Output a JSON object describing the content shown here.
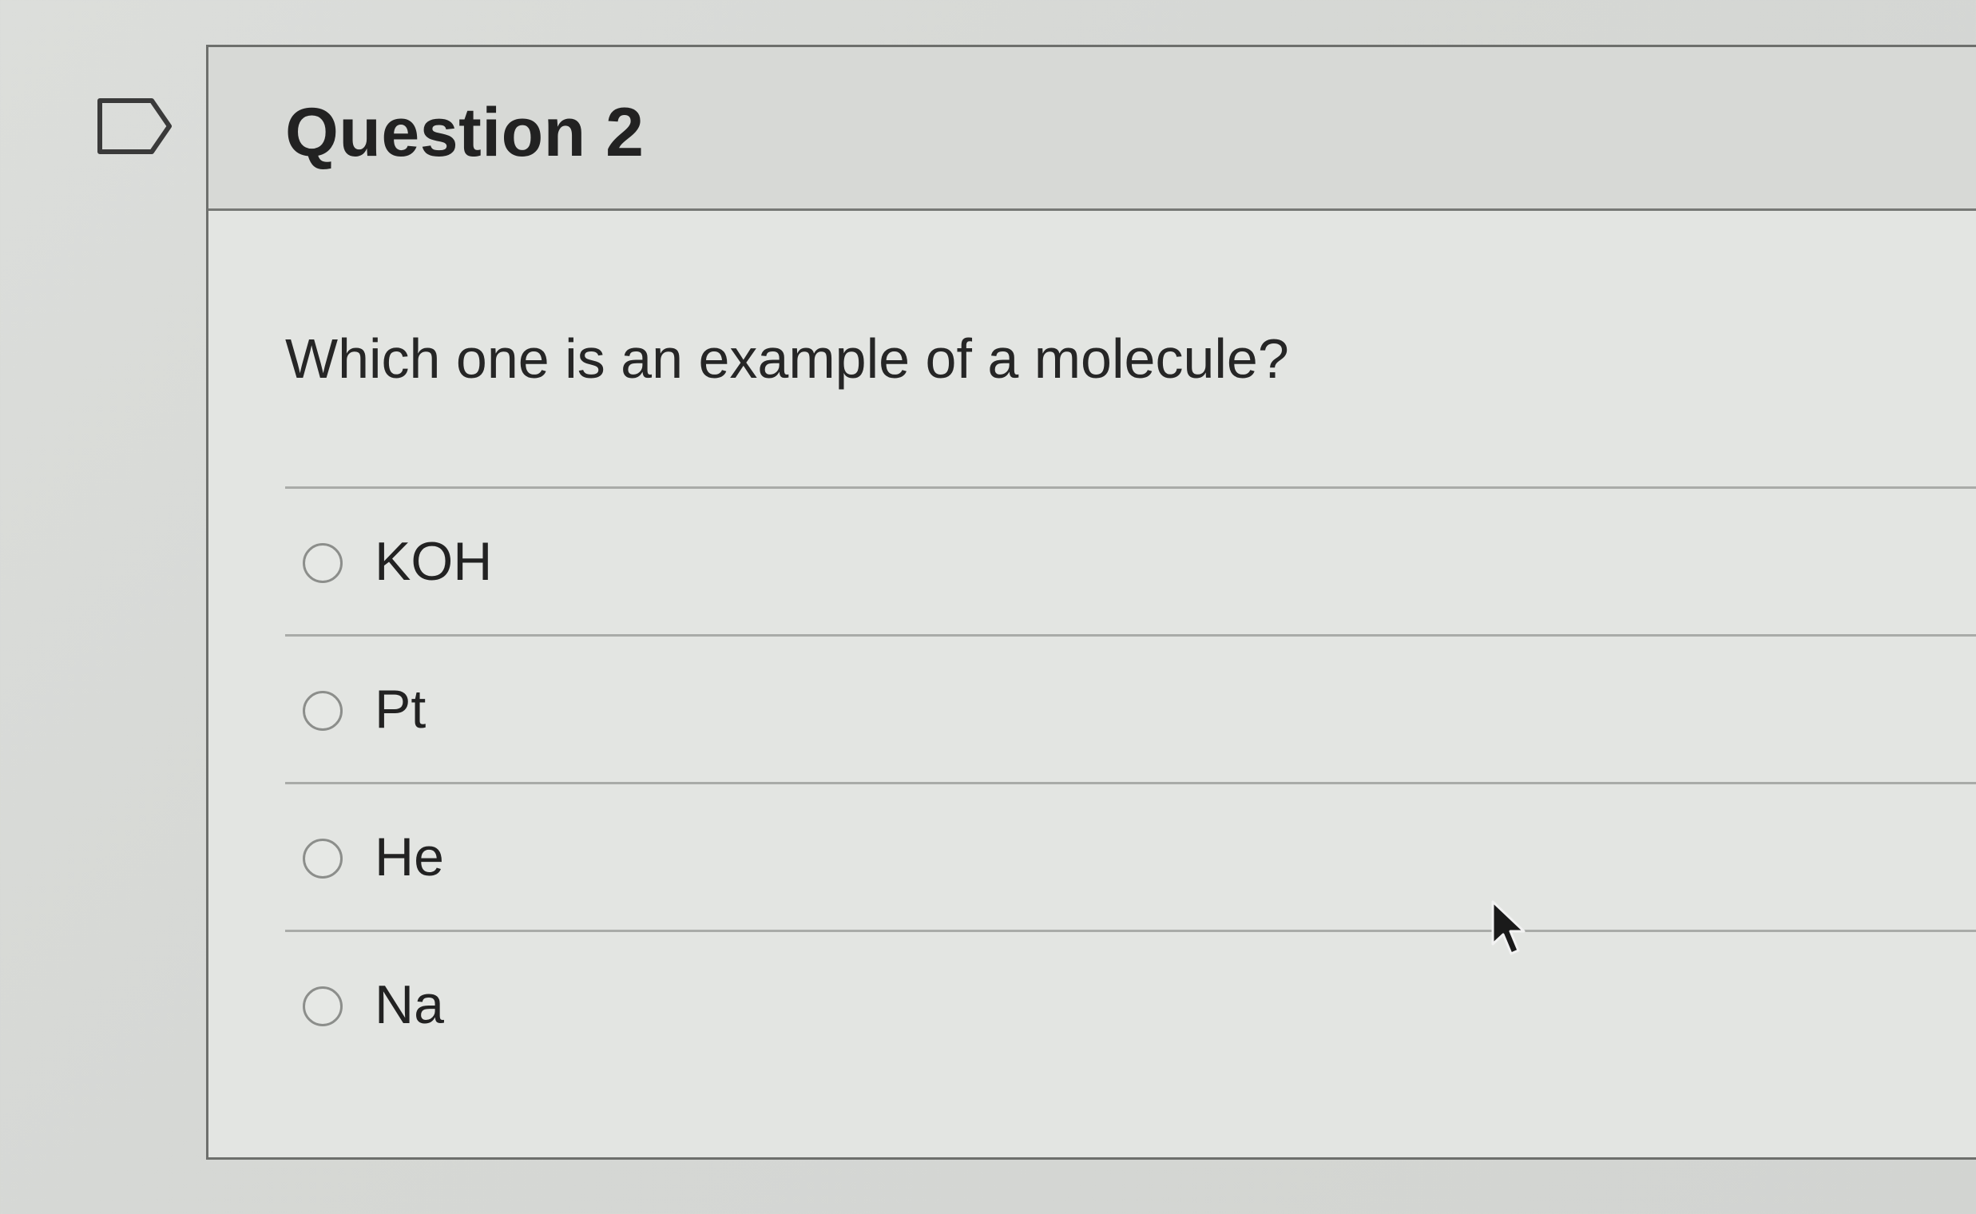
{
  "question": {
    "title": "Question 2",
    "text": "Which one is an example of a molecule?",
    "flag_icon": "flag-outline-icon",
    "answers": [
      {
        "label": "KOH",
        "selected": false
      },
      {
        "label": "Pt",
        "selected": false
      },
      {
        "label": "He",
        "selected": false
      },
      {
        "label": "Na",
        "selected": false
      }
    ]
  },
  "colors": {
    "background": "#d6d8d5",
    "card_body": "#e3e5e2",
    "card_header": "#d7d9d6",
    "border": "#6d6f6c",
    "divider": "#a9aba8",
    "text": "#222222"
  },
  "cursor_icon": "mouse-pointer-icon"
}
